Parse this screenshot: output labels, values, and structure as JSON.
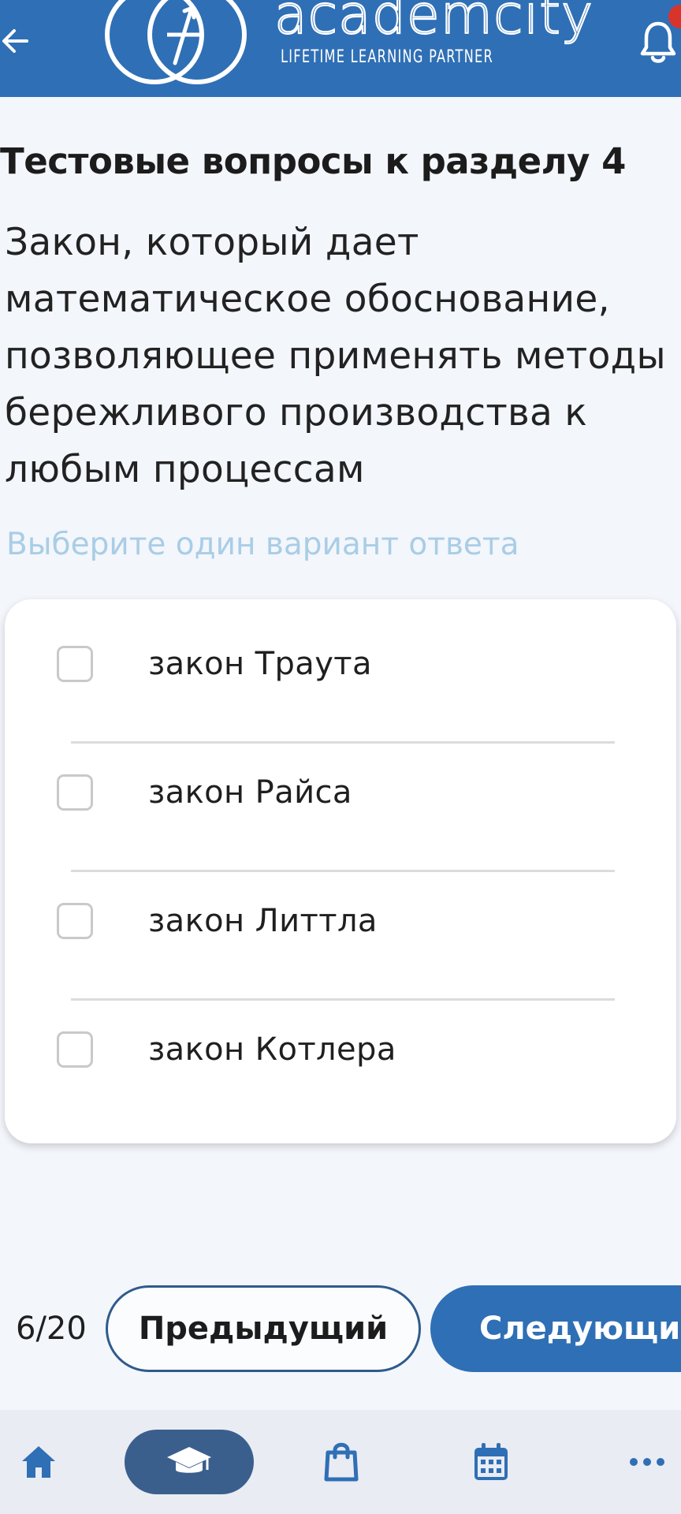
{
  "header": {
    "brand_name": "academcity",
    "tagline": "LIFETIME LEARNING PARTNER",
    "back_icon": "arrow-left-icon",
    "notification_icon": "bell-icon",
    "colors": {
      "bar": "#2f6fb5",
      "badge": "#d9342b"
    }
  },
  "quiz": {
    "section_title": "Тестовые вопросы к разделу 4",
    "question": "Закон, который дает математическое обоснование, позволяющее применять методы бережливого производства к любым процессам",
    "hint": "Выберите один вариант ответа",
    "options": [
      {
        "label": "закон Траута",
        "checked": false
      },
      {
        "label": "закон Райса",
        "checked": false
      },
      {
        "label": "закон Литтла",
        "checked": false
      },
      {
        "label": "закон Котлера",
        "checked": false
      }
    ]
  },
  "navigation": {
    "counter": "6/20",
    "prev_label": "Предыдущий",
    "next_label": "Следующий",
    "accent": "#2f6fb5"
  },
  "tabbar": {
    "items": [
      {
        "icon": "home-icon",
        "active": false
      },
      {
        "icon": "graduation-cap-icon",
        "active": true
      },
      {
        "icon": "shopping-bag-icon",
        "active": false
      },
      {
        "icon": "calendar-icon",
        "active": false
      },
      {
        "icon": "more-icon",
        "active": false
      }
    ]
  }
}
